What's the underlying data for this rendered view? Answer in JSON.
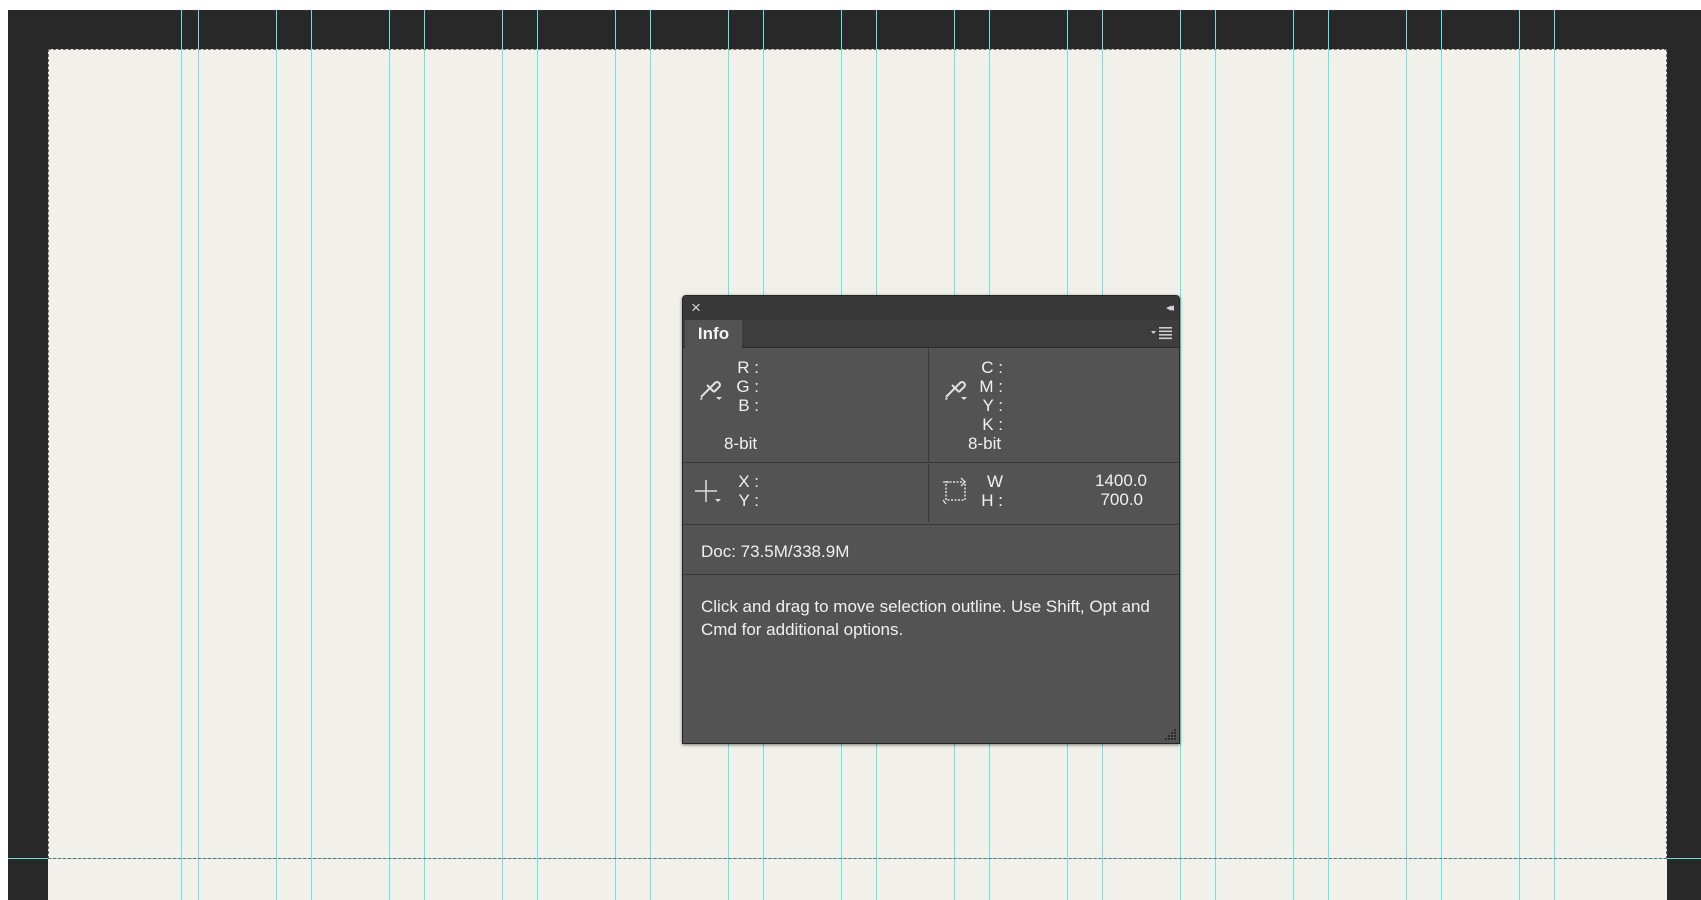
{
  "panel": {
    "tab_label": "Info",
    "close_glyph": "×",
    "collapse_glyph": "◂◂",
    "rgb": {
      "r_label": "R :",
      "g_label": "G :",
      "b_label": "B :",
      "bit_depth": "8-bit"
    },
    "cmyk": {
      "c_label": "C :",
      "m_label": "M :",
      "y_label": "Y :",
      "k_label": "K :",
      "bit_depth": "8-bit"
    },
    "position": {
      "x_label": "X :",
      "y_label": "Y :"
    },
    "size": {
      "w_label": "W :",
      "h_label": "H :",
      "w_value": "1400.0",
      "h_value": "700.0"
    },
    "doc": "Doc: 73.5M/338.9M",
    "help": "Click and drag to move selection outline.  Use Shift, Opt and Cmd for additional options."
  },
  "icons": {
    "close": "close-icon",
    "collapse": "double-chevron-left-icon",
    "menu": "panel-menu-icon",
    "eyedropper_rgb": "eyedropper-icon",
    "eyedropper_cmyk": "eyedropper-icon",
    "crosshair": "crosshair-icon",
    "selection_size": "selection-size-icon",
    "resize": "resize-grip-icon"
  },
  "colors": {
    "guide": "#6ee0e6",
    "panel_bg": "#535353",
    "canvas_bg": "#f2f0ea",
    "workspace_bg": "#282828"
  }
}
